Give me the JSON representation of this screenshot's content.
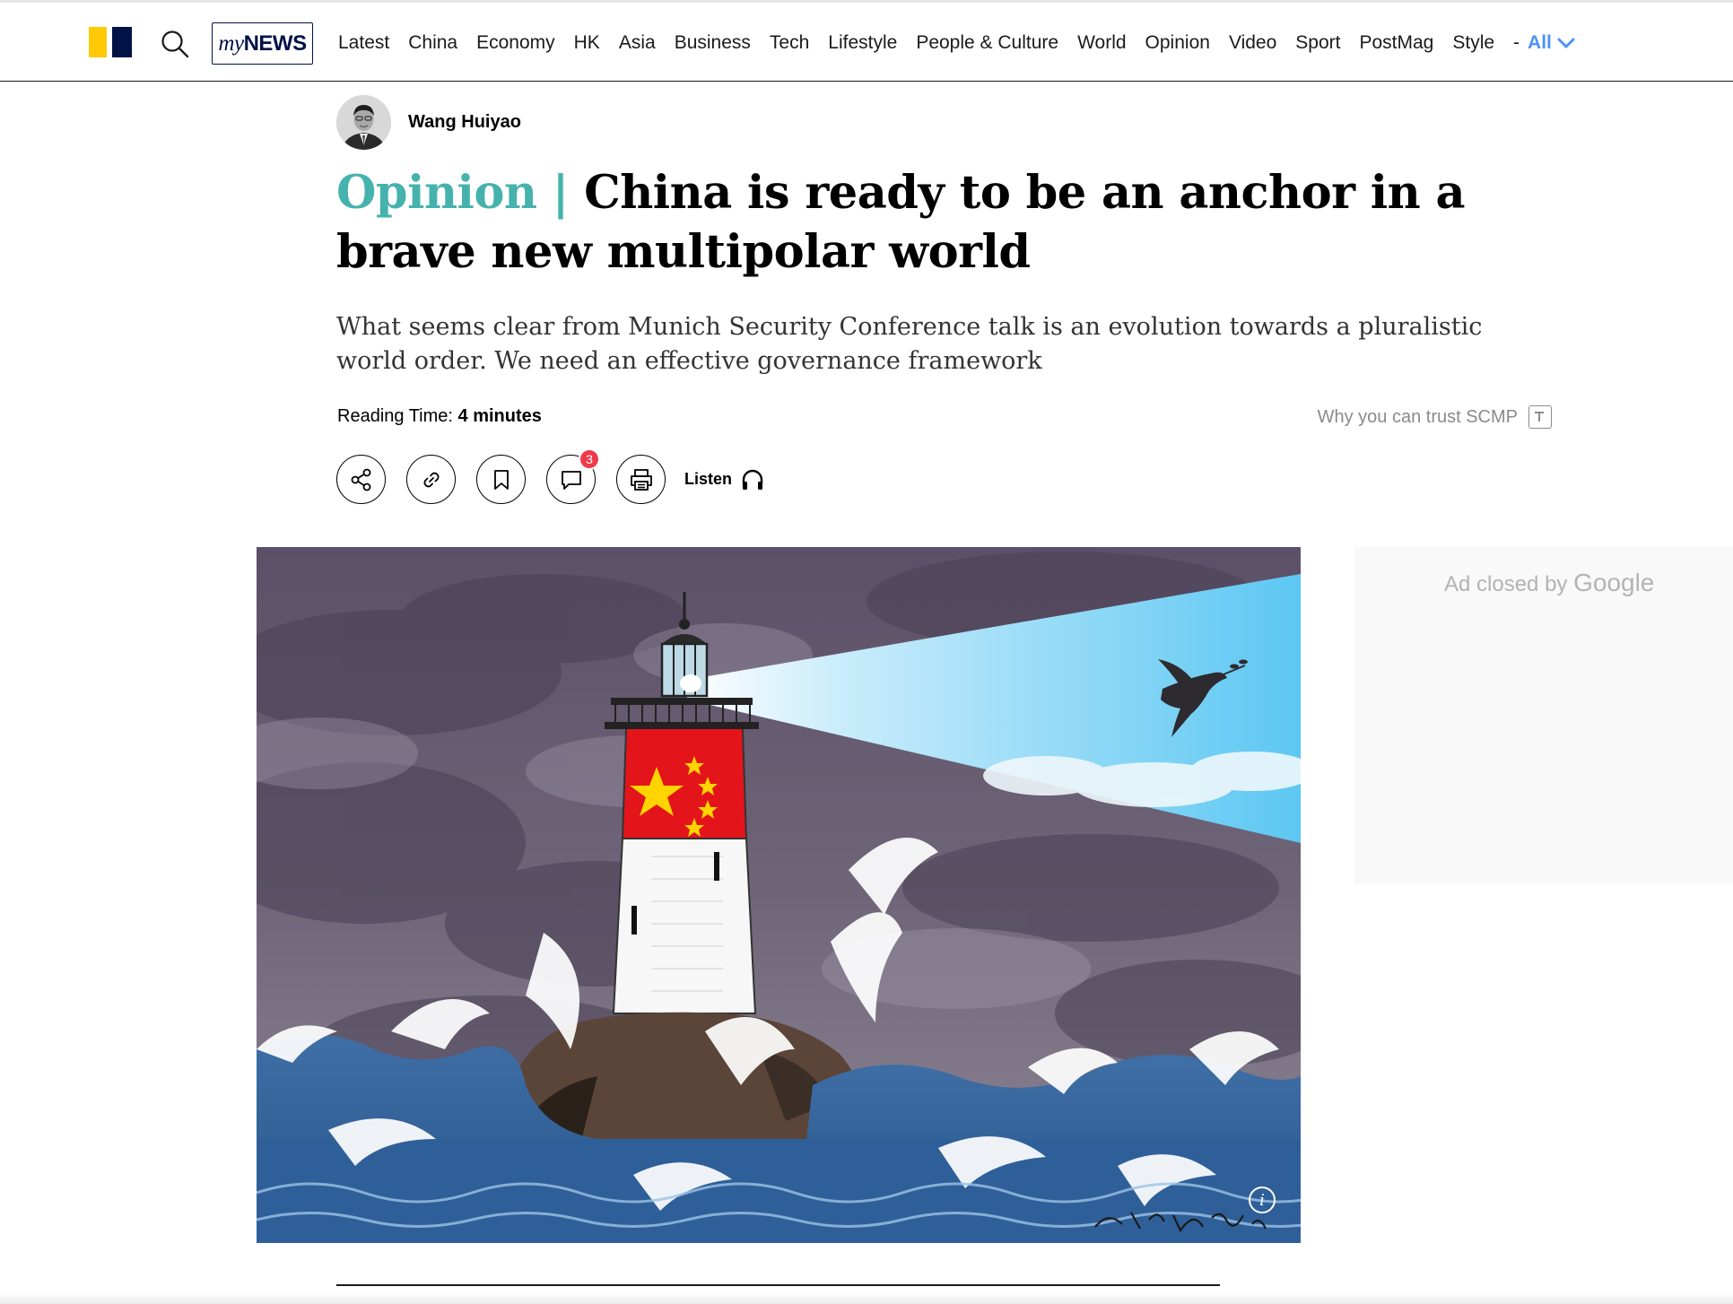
{
  "nav": {
    "brand": {
      "label": "myNEWS",
      "label_my": "my",
      "label_news": "NEWS"
    },
    "items": [
      "Latest",
      "China",
      "Economy",
      "HK",
      "Asia",
      "Business",
      "Tech",
      "Lifestyle",
      "People & Culture",
      "World",
      "Opinion",
      "Video",
      "Sport",
      "PostMag",
      "Style"
    ],
    "separator": "-",
    "all_label": "All"
  },
  "article": {
    "author": "Wang Huiyao",
    "section_label": "Opinion",
    "separator": "|",
    "title": "China is ready to be an anchor in a brave new multipolar world",
    "summary": "What seems clear from Munich Security Conference talk is an evolution towards a pluralistic world order. We need an effective governance framework",
    "reading_time_label": "Reading Time:",
    "reading_time_value": "4 minutes",
    "trust_label": "Why you can trust SCMP"
  },
  "actions": {
    "comment_count": "3",
    "listen_label": "Listen"
  },
  "ad": {
    "closed_prefix": "Ad closed by",
    "closed_brand": "Google"
  },
  "hero": {
    "info_glyph": "i"
  },
  "colors": {
    "opinion_accent": "#46b2ad",
    "brand_yellow": "#ffca05",
    "brand_navy": "#001246",
    "all_link": "#4e92f5",
    "badge_red": "#ee3b4c"
  },
  "icons": [
    "search-icon",
    "share-icon",
    "link-icon",
    "bookmark-icon",
    "comment-icon",
    "print-icon",
    "headphones-icon",
    "chevron-down-icon",
    "trust-icon",
    "info-icon"
  ]
}
